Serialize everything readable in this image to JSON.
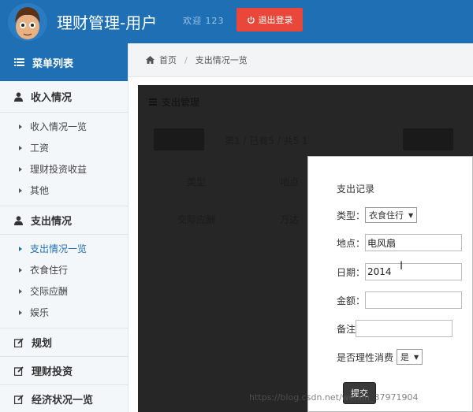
{
  "header": {
    "title": "理财管理-用户",
    "welcome": "欢迎  123",
    "logout_label": "退出登录",
    "colors": {
      "bar": "#1f6fb5",
      "logout": "#e8473a"
    }
  },
  "sidebar": {
    "menu_header": "菜单列表",
    "sections": [
      {
        "label": "收入情况",
        "icon": "user-icon",
        "items": [
          "收入情况一览",
          "工资",
          "理财投资收益",
          "其他"
        ]
      },
      {
        "label": "支出情况",
        "icon": "user-icon",
        "items": [
          "支出情况一览",
          "衣食住行",
          "交际应酬",
          "娱乐"
        ],
        "active_item": "支出情况一览"
      },
      {
        "label": "规划",
        "icon": "edit-icon"
      },
      {
        "label": "理财投资",
        "icon": "edit-icon"
      },
      {
        "label": "经济状况一览",
        "icon": "edit-icon"
      }
    ]
  },
  "breadcrumb": {
    "home": "首页",
    "current": "支出情况一览"
  },
  "panel": {
    "title": "支出管理",
    "info_text": "第1 / 已有5 / 共5 1",
    "col_type": "类型",
    "col_place": "地点",
    "row_type": "交际应酬",
    "row_place": "万达"
  },
  "modal": {
    "title": "支出记录",
    "type_label": "类型：",
    "type_value": "衣食住行",
    "place_label": "地点：",
    "place_value": "电风扇",
    "date_label": "日期：",
    "date_value": "2014",
    "amount_label": "金额：",
    "amount_value": "",
    "note_label": "备注",
    "note_value": "",
    "rational_label": "是否理性消费",
    "rational_value": "是",
    "submit_label": "提交"
  },
  "watermark": "https://blog.csdn.net/weixin_37971904"
}
